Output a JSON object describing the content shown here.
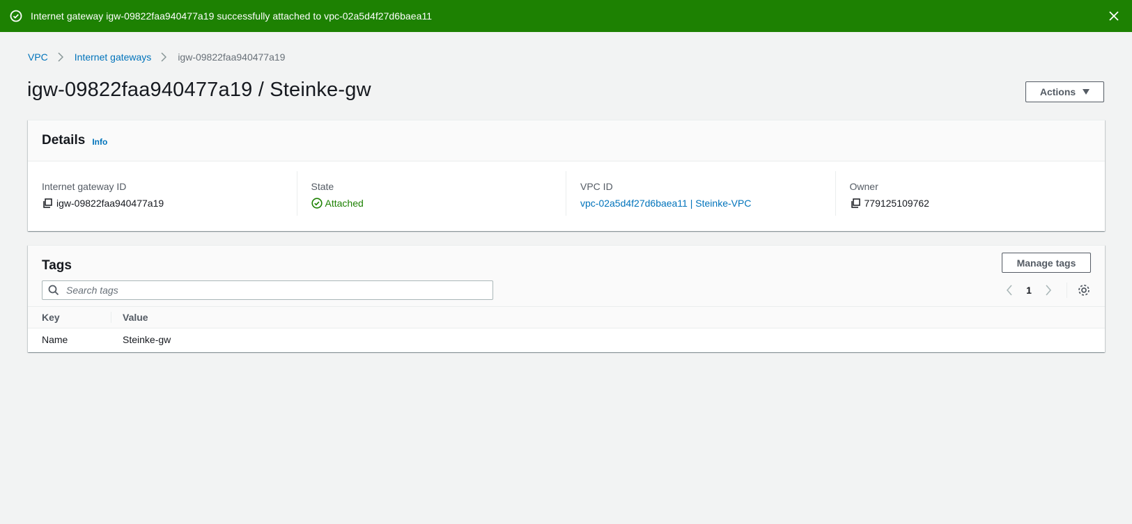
{
  "flash": {
    "message": "Internet gateway igw-09822faa940477a19 successfully attached to vpc-02a5d4f27d6baea11",
    "color": "#1d8102"
  },
  "breadcrumb": {
    "items": [
      "VPC",
      "Internet gateways"
    ],
    "current": "igw-09822faa940477a19"
  },
  "page": {
    "title": "igw-09822faa940477a19 / Steinke-gw",
    "actions_label": "Actions"
  },
  "details": {
    "title": "Details",
    "info_label": "Info",
    "fields": [
      {
        "label": "Internet gateway ID",
        "value": "igw-09822faa940477a19"
      },
      {
        "label": "State",
        "value": "Attached"
      },
      {
        "label": "VPC ID",
        "value": "vpc-02a5d4f27d6baea11 | Steinke-VPC"
      },
      {
        "label": "Owner",
        "value": "779125109762"
      }
    ]
  },
  "tags": {
    "title": "Tags",
    "manage_label": "Manage tags",
    "search_placeholder": "Search tags",
    "page_number": "1",
    "columns": [
      "Key",
      "Value"
    ],
    "rows": [
      {
        "key": "Name",
        "value": "Steinke-gw"
      }
    ]
  },
  "colors": {
    "link": "#0073bb",
    "success": "#1d8102"
  }
}
